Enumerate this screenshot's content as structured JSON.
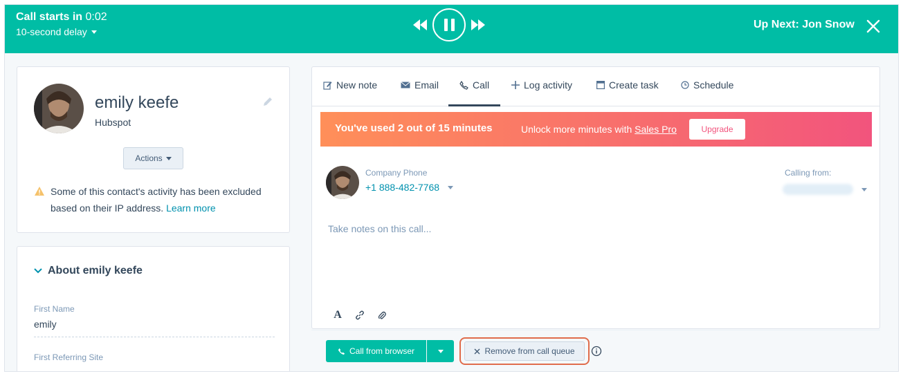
{
  "topbar": {
    "call_starts_label": "Call starts in",
    "countdown": "0:02",
    "delay_label": "10-second delay",
    "up_next": "Up Next: Jon Snow",
    "background_color": "#00bda5"
  },
  "contact": {
    "name": "emily keefe",
    "company": "Hubspot",
    "actions_label": "Actions",
    "warning_text": "Some of this contact's activity has been excluded based on their IP address.",
    "learn_more": "Learn more"
  },
  "about": {
    "title": "About emily keefe",
    "fields": [
      {
        "label": "First Name",
        "value": "emily"
      },
      {
        "label": "First Referring Site",
        "value": ""
      }
    ]
  },
  "tabs": [
    {
      "label": "New note",
      "icon": "pencil-square-icon"
    },
    {
      "label": "Email",
      "icon": "envelope-icon"
    },
    {
      "label": "Call",
      "icon": "phone-icon",
      "active": true
    },
    {
      "label": "Log activity",
      "icon": "plus-icon"
    },
    {
      "label": "Create task",
      "icon": "task-icon"
    },
    {
      "label": "Schedule",
      "icon": "clock-icon"
    }
  ],
  "banner": {
    "main": "You've used 2 out of 15 minutes",
    "sub_prefix": "Unlock more minutes with",
    "sub_link": "Sales Pro",
    "upgrade_label": "Upgrade",
    "gradient_start": "#ff8f59",
    "gradient_end": "#f2547d"
  },
  "call": {
    "phone_label": "Company Phone",
    "phone_number": "+1 888-482-7768",
    "calling_from_label": "Calling from:",
    "notes_placeholder": "Take notes on this call..."
  },
  "footer": {
    "call_button": "Call from browser",
    "remove_button": "Remove from call queue"
  }
}
